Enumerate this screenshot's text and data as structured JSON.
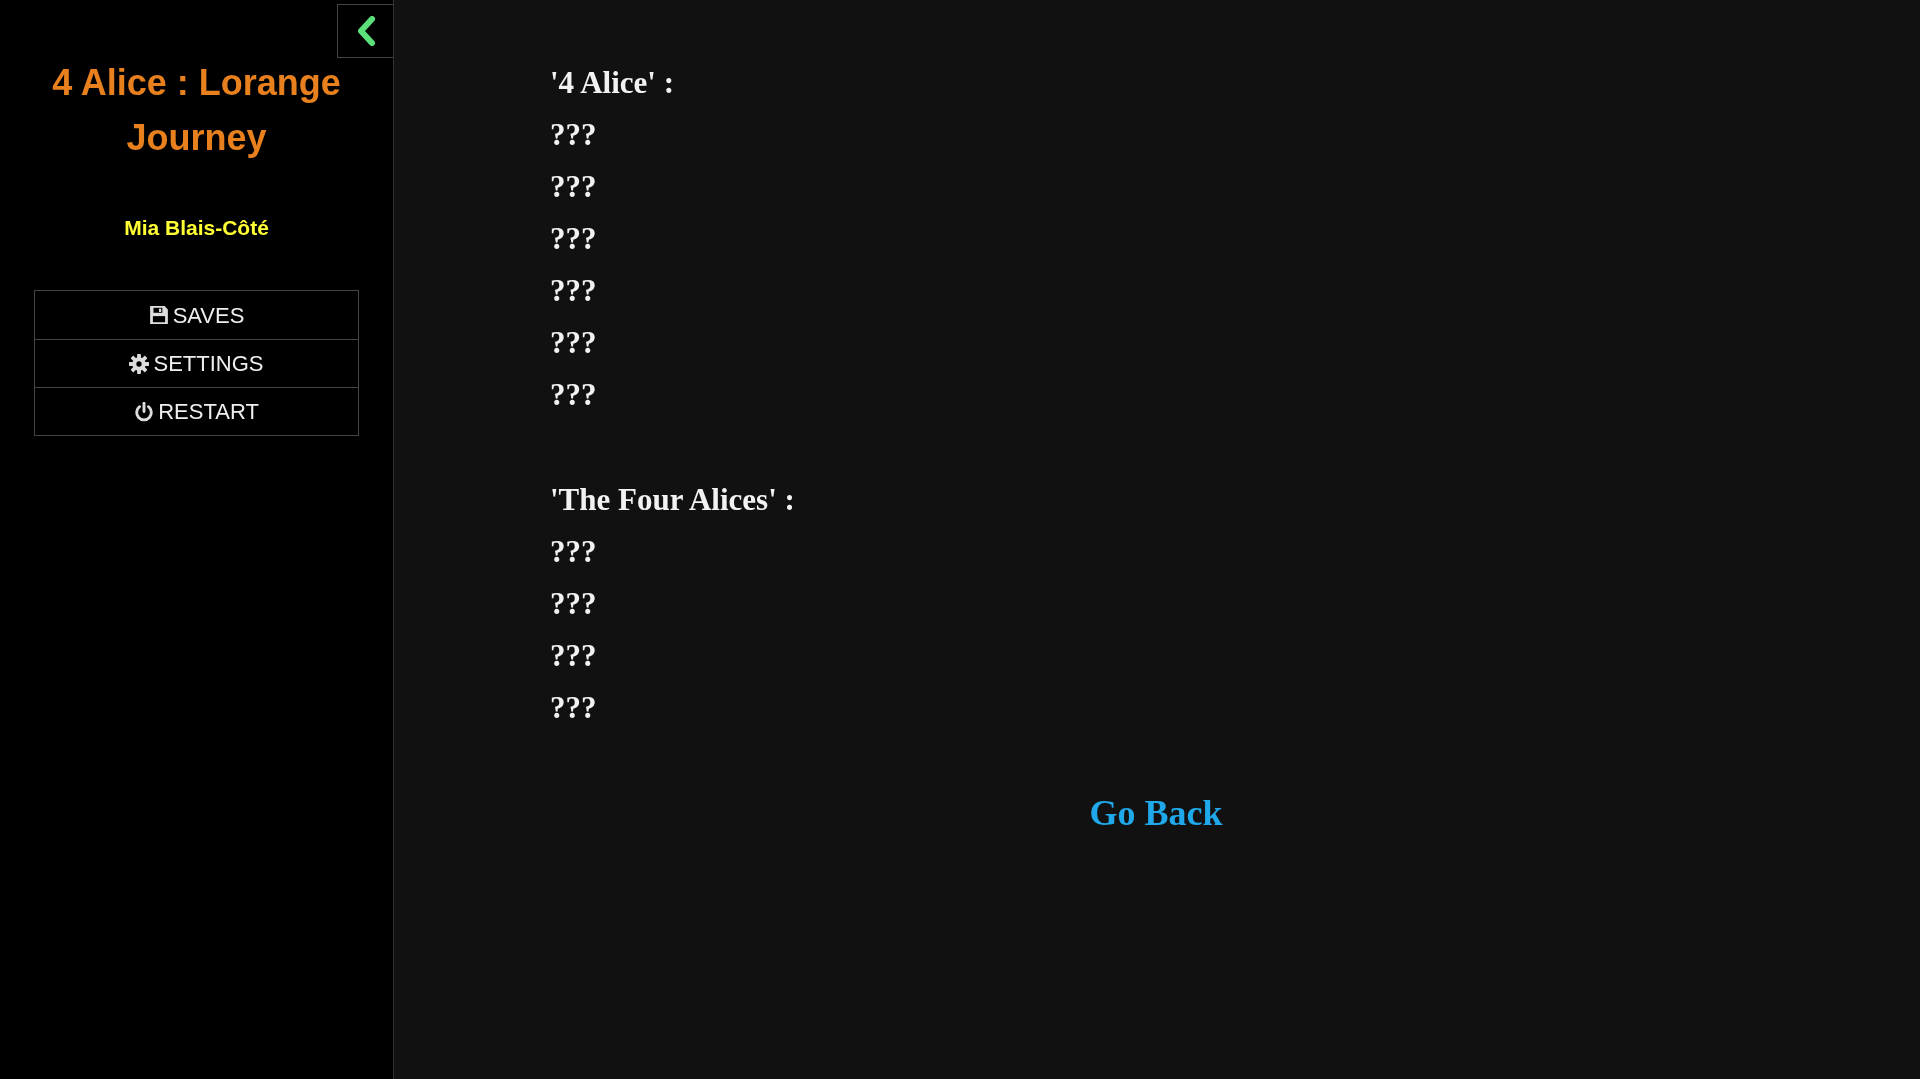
{
  "sidebar": {
    "story_title": "4 Alice : Lorange Journey",
    "story_author": "Mia Blais-Côté",
    "menu": [
      {
        "kind": "saves",
        "label": "SAVES"
      },
      {
        "kind": "settings",
        "label": "SETTINGS"
      },
      {
        "kind": "restart",
        "label": "RESTART"
      }
    ]
  },
  "passage": {
    "sections": [
      {
        "heading": "'4 Alice' :",
        "entries": [
          "???",
          "???",
          "???",
          "???",
          "???",
          "???"
        ]
      },
      {
        "heading": "'The Four Alices' :",
        "entries": [
          "???",
          "???",
          "???",
          "???"
        ]
      }
    ],
    "link": "Go Back"
  }
}
